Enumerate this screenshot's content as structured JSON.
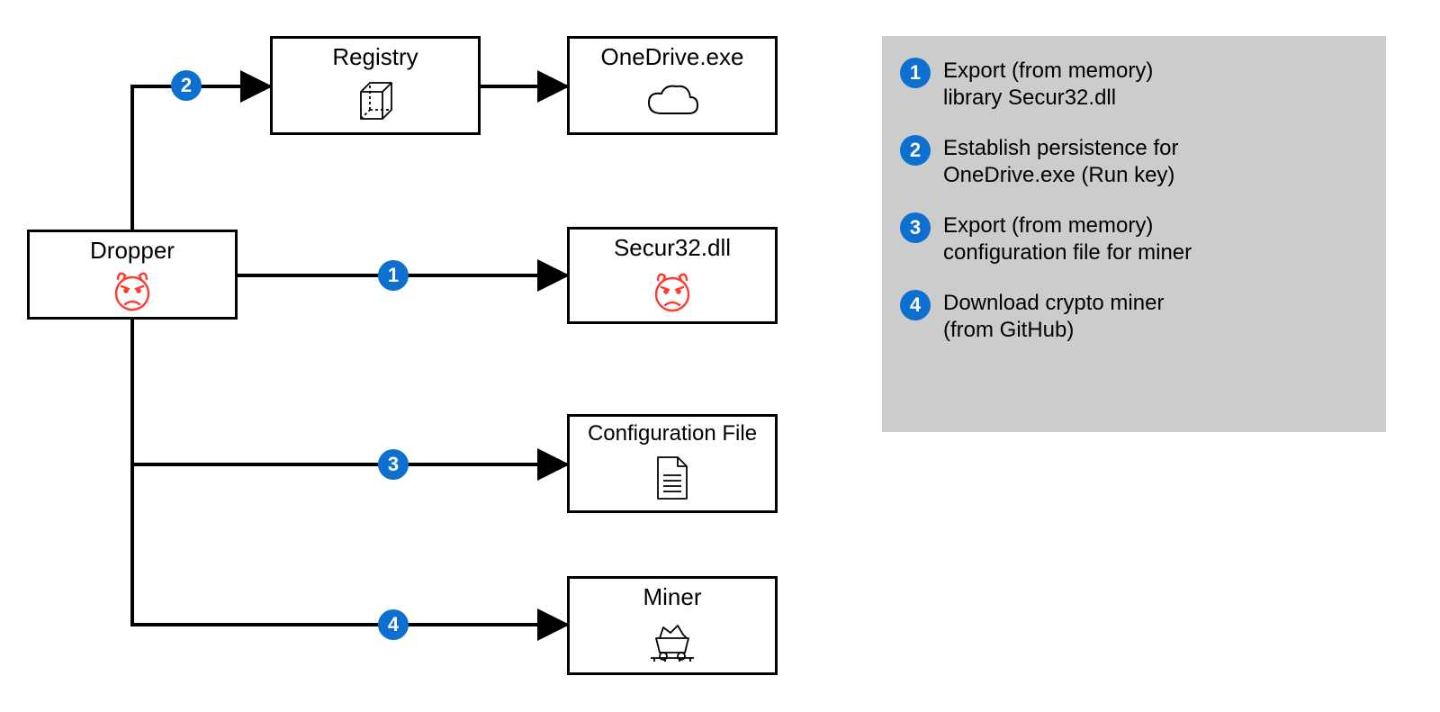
{
  "nodes": {
    "dropper": "Dropper",
    "registry": "Registry",
    "onedrive": "OneDrive.exe",
    "secur32": "Secur32.dll",
    "config": "Configuration File",
    "miner": "Miner"
  },
  "badges": {
    "b1": "1",
    "b2": "2",
    "b3": "3",
    "b4": "4"
  },
  "legend": {
    "l1": "Export (from memory)\nlibrary Secur32.dll",
    "l2": "Establish persistence for\nOneDrive.exe (Run key)",
    "l3": "Export (from memory)\nconfiguration file for miner",
    "l4": "Download crypto miner\n(from GitHub)"
  },
  "colors": {
    "badge": "#0d6fcf",
    "malware": "#ff3b30",
    "panel": "#cccccc"
  }
}
